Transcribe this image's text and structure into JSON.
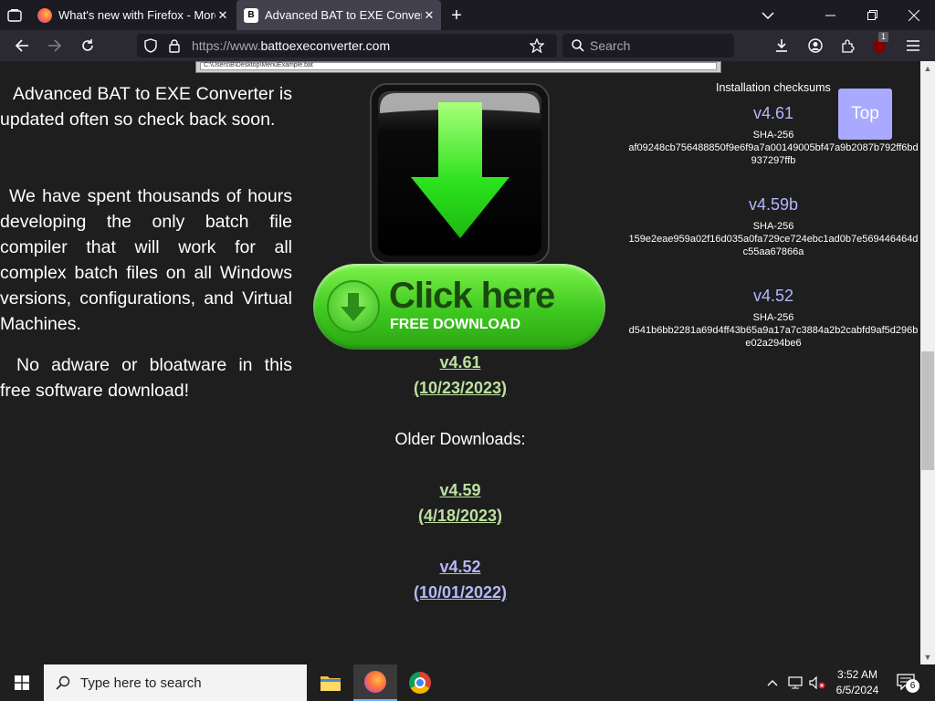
{
  "tabs": [
    {
      "label": "What's new with Firefox - More",
      "icon": "firefox-icon",
      "active": false
    },
    {
      "label": "Advanced BAT to EXE Converter",
      "icon": "bat-to-exe-site-icon",
      "active": true
    }
  ],
  "nav": {
    "url_scheme": "https://www.",
    "url_host": "battoexeconverter.com",
    "search_placeholder": "Search",
    "extension_badge": "1"
  },
  "page": {
    "address_snippet": "C:\\Users\\B\\Desktop\\MenuExample.bat",
    "left_paragraphs": [
      "Advanced BAT to EXE Converter is updated often so check back soon.",
      "We have spent thousands of hours developing the only batch file compiler that will work for all complex batch files on all Windows versions, configurations, and Virtual Machines.",
      "No adware or bloatware in this free software download!"
    ],
    "download_button": {
      "title": "Click here",
      "subtitle": "FREE DOWNLOAD"
    },
    "current_version": "v4.61",
    "current_date": "(10/23/2023)",
    "older_heading": "Older Downloads:",
    "older": [
      {
        "version": "v4.59",
        "date": "(4/18/2023)"
      },
      {
        "version": "v4.52",
        "date": "(10/01/2022)"
      }
    ],
    "checksums_heading": "Installation checksums",
    "checksums": [
      {
        "version": "v4.61",
        "algo": "SHA-256",
        "hash": "af09248cb756488850f9e6f9a7a00149005bf47a9b2087b792ff6bd937297ffb"
      },
      {
        "version": "v4.59b",
        "algo": "SHA-256",
        "hash": "159e2eae959a02f16d035a0fa729ce724ebc1ad0b7e569446464dc55aa67866a"
      },
      {
        "version": "v4.52",
        "algo": "SHA-256",
        "hash": "d541b6bb2281a69d4ff43b65a9a17a7c3884a2b2cabfd9af5d296be02a294be6"
      }
    ],
    "top_button": "Top"
  },
  "taskbar": {
    "search_placeholder": "Type here to search",
    "time": "3:52 AM",
    "date": "6/5/2024",
    "notification_count": "6"
  },
  "colors": {
    "accent_green": "#bde0a0",
    "accent_blue": "#b5b5ff",
    "top_button": "#a9a9ff"
  }
}
